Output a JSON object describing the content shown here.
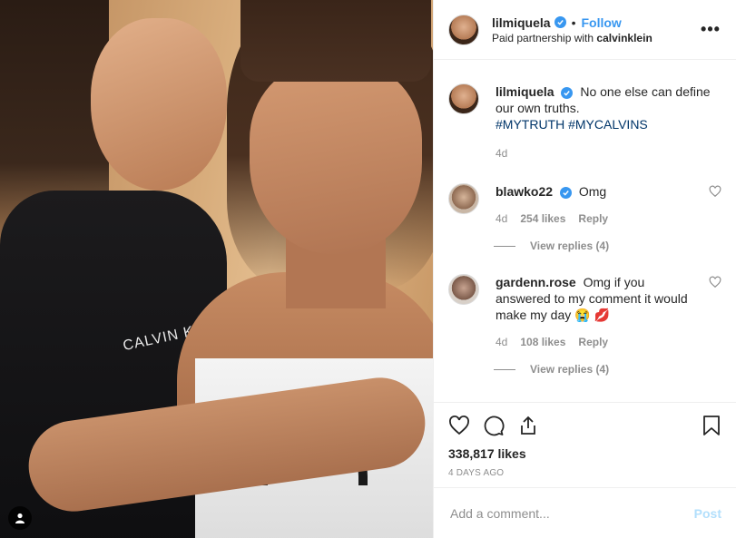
{
  "photo": {
    "shirt_text": "CALVIN K"
  },
  "header": {
    "username": "lilmiquela",
    "separator": "•",
    "follow_label": "Follow",
    "partnership_prefix": "Paid partnership with ",
    "partner": "calvinklein",
    "more_label": "•••"
  },
  "caption": {
    "username": "lilmiquela",
    "text": "No one else can define our own truths.",
    "hashtags": "#MYTRUTH #MYCALVINS",
    "age": "4d"
  },
  "comments": [
    {
      "username": "blawko22",
      "text": "Omg",
      "age": "4d",
      "likes": "254 likes",
      "reply_label": "Reply",
      "view_replies": "View replies (4)"
    },
    {
      "username": "gardenn.rose",
      "text": "Omg if you answered to my comment it would make my day 😭 💋",
      "age": "4d",
      "likes": "108 likes",
      "reply_label": "Reply",
      "view_replies": "View replies (4)"
    }
  ],
  "actions": {
    "likes_count": "338,817 likes",
    "date": "4 DAYS AGO"
  },
  "add_comment": {
    "placeholder": "Add a comment...",
    "post_label": "Post"
  },
  "icons": {
    "user_tag": "user-icon",
    "verified": "verified-badge-icon",
    "like": "heart-icon",
    "comment": "comment-bubble-icon",
    "share": "share-icon",
    "save": "bookmark-icon"
  },
  "colors": {
    "accent": "#3897f0",
    "hashtag": "#003569",
    "muted": "#8e8e8e",
    "post_disabled": "#b2dffc"
  }
}
